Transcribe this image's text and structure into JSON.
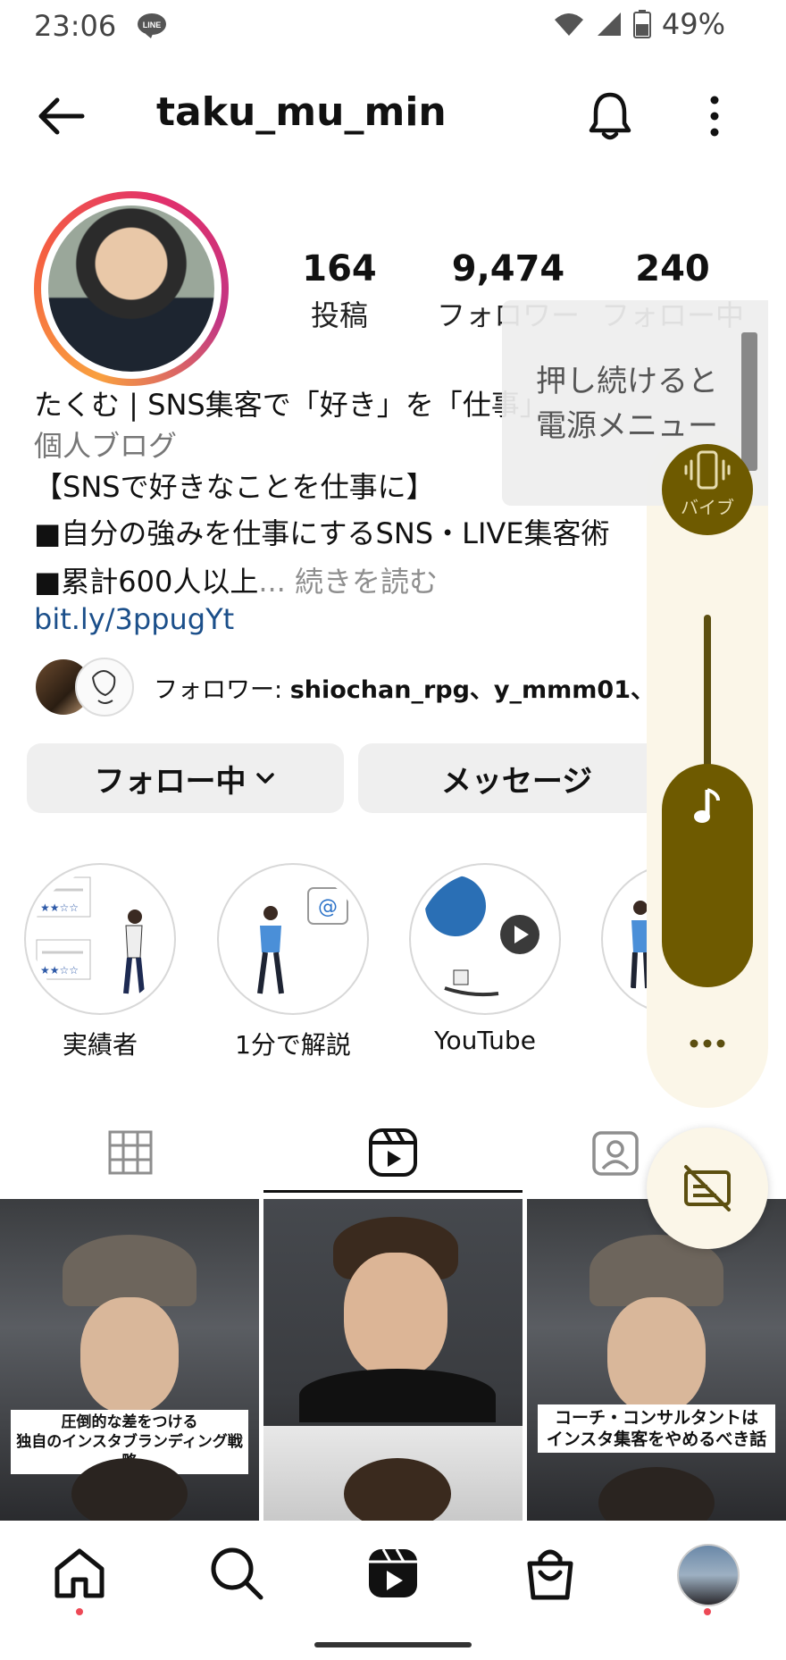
{
  "status_bar": {
    "time": "23:06",
    "line_badge": "LINE",
    "battery": "49%"
  },
  "header": {
    "username": "taku_mu_min"
  },
  "stats": [
    {
      "number": "164",
      "label": "投稿"
    },
    {
      "number": "9,474",
      "label": "フォロワー"
    },
    {
      "number": "240",
      "label": "フォロー中"
    }
  ],
  "bio": {
    "name": "たくむ | SNS集客で「好き」を「仕事」に",
    "category": "個人ブログ",
    "line1": "【SNSで好きなことを仕事に】",
    "line2": "■自分の強みを仕事にするSNS・LIVE集客術",
    "line3": "■累計600人以上",
    "more": "... 続きを読む",
    "link": "bit.ly/3ppugYt"
  },
  "followed_by": {
    "prefix": "フォロワー: ",
    "names": "shiochan_rpg、y_mmm01、他"
  },
  "buttons": {
    "following": "フォロー中",
    "message": "メッセージ"
  },
  "highlights": [
    {
      "label": "実績者"
    },
    {
      "label": "1分で解説"
    },
    {
      "label": "YouTube"
    },
    {
      "label": ""
    }
  ],
  "highlight_at_symbol": "@",
  "grid": [
    {
      "caption_line1": "圧倒的な差をつける",
      "caption_line2": "独自のインスタブランディング戦略"
    },
    {
      "caption_line1": "",
      "caption_line2": ""
    },
    {
      "caption_line1": "コーチ・コンサルタントは",
      "caption_line2": "インスタ集客をやめるべき話"
    }
  ],
  "power_menu": {
    "line1": "押し続けると",
    "line2": "電源メニュー"
  },
  "volume_panel": {
    "vibrate_label": "バイブ"
  },
  "colors": {
    "link": "#1b4f8a",
    "notification_dot": "#ed4956",
    "volume_accent": "#6e5a00",
    "volume_panel_bg": "#fbf6e8"
  },
  "icons": [
    "back-arrow-icon",
    "bell-icon",
    "more-vert-icon",
    "grid-icon",
    "reels-icon",
    "tagged-icon",
    "home-icon",
    "search-icon",
    "reels-nav-icon",
    "shop-icon",
    "vibrate-icon",
    "music-note-icon",
    "captions-off-icon",
    "wifi-icon",
    "signal-icon",
    "battery-icon"
  ]
}
